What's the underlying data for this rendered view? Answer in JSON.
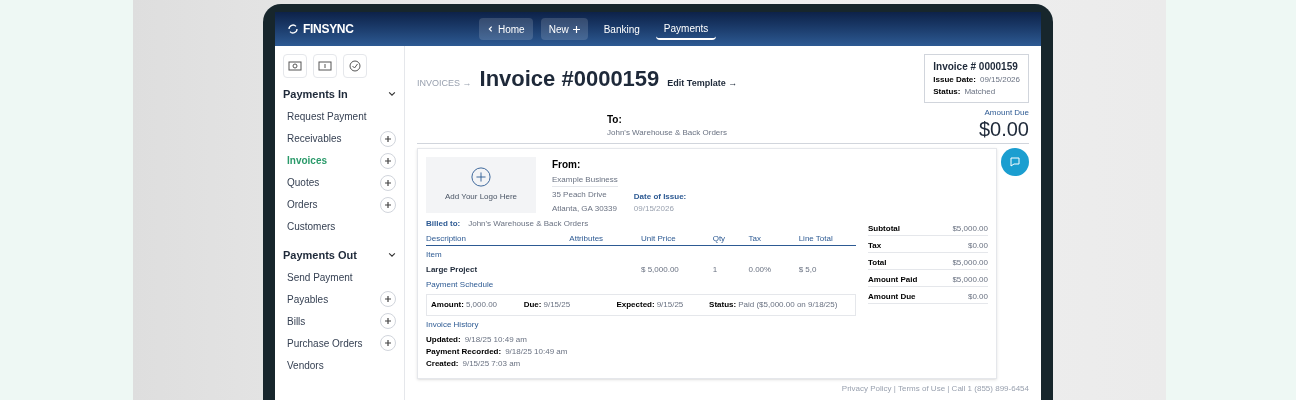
{
  "header": {
    "logo": "FINSYNC",
    "nav": [
      {
        "label": "Home",
        "kind": "back",
        "selected": false
      },
      {
        "label": "New",
        "kind": "add",
        "selected": false
      },
      {
        "label": "Banking",
        "kind": "plain",
        "selected": false
      },
      {
        "label": "Payments",
        "kind": "plain",
        "selected": true
      }
    ]
  },
  "sidebar": {
    "sections": [
      {
        "title": "Payments In",
        "items": [
          {
            "label": "Request Payment",
            "kind": "plain",
            "selected": false
          },
          {
            "label": "Receivables",
            "kind": "add",
            "selected": false
          },
          {
            "label": "Invoices",
            "kind": "add",
            "selected": true
          },
          {
            "label": "Quotes",
            "kind": "add",
            "selected": false
          },
          {
            "label": "Orders",
            "kind": "add",
            "selected": false
          },
          {
            "label": "Customers",
            "kind": "plain",
            "selected": false
          }
        ]
      },
      {
        "title": "Payments Out",
        "items": [
          {
            "label": "Send Payment",
            "kind": "plain",
            "selected": false
          },
          {
            "label": "Payables",
            "kind": "add",
            "selected": false
          },
          {
            "label": "Bills",
            "kind": "add",
            "selected": false
          },
          {
            "label": "Purchase Orders",
            "kind": "add",
            "selected": false
          },
          {
            "label": "Vendors",
            "kind": "plain",
            "selected": false
          }
        ]
      }
    ]
  },
  "invoice": {
    "breadcrumb": "INVOICES →",
    "title": "Invoice #0000159",
    "edit_link": "Edit Template →",
    "summary": {
      "number": "Invoice # 0000159",
      "issue_date_label": "Issue Date:",
      "issue_date": "09/15/2026",
      "status_label": "Status:",
      "status": "Matched"
    },
    "amount_due_label": "Amount Due",
    "amount_due": "$0.00",
    "to_label": "To:",
    "to": "John's Warehouse & Back Orders",
    "logo_prompt": "Add Your Logo Here",
    "from_label": "From:",
    "from_name": "Example Business",
    "from_address": [
      "35 Peach Drive",
      "Atlanta, GA 30339"
    ],
    "date_label": "Date of Issue:",
    "date": "09/15/2026",
    "billed_label": "Billed to:",
    "billed": "John's Warehouse & Back Orders",
    "columns": [
      "Description",
      "Attributes",
      "Unit Price",
      "Qty",
      "Tax",
      "Line Total"
    ],
    "item_label": "Item",
    "row": {
      "item": "Large Project",
      "unit_price": "$ 5,000.00",
      "qty": "1",
      "tax": "0.00%",
      "line_total": "$ 5,0"
    },
    "schedule_label": "Payment Schedule",
    "schedule": [
      {
        "label": "Amount:",
        "value": "5,000.00"
      },
      {
        "label": "Due:",
        "value": "9/15/25"
      },
      {
        "label": "Expected:",
        "value": "9/15/25"
      },
      {
        "label": "Status:",
        "value": "Paid ($5,000.00 on 9/18/25)"
      }
    ],
    "history_label": "Invoice History",
    "history": [
      {
        "label": "Updated:",
        "value": "9/18/25 10:49 am"
      },
      {
        "label": "Payment Recorded:",
        "value": "9/18/25 10:49 am"
      },
      {
        "label": "Created:",
        "value": "9/15/25 7:03 am"
      }
    ],
    "totals": [
      {
        "label": "Subtotal",
        "value": "$5,000.00"
      },
      {
        "label": "Tax",
        "value": "$0.00"
      },
      {
        "label": "Total",
        "value": "$5,000.00"
      },
      {
        "label": "Amount Paid",
        "value": "$5,000.00"
      },
      {
        "label": "Amount Due",
        "value": "$0.00"
      }
    ]
  },
  "footer": "Privacy Policy | Terms of Use | Call 1 (855) 899-6454"
}
